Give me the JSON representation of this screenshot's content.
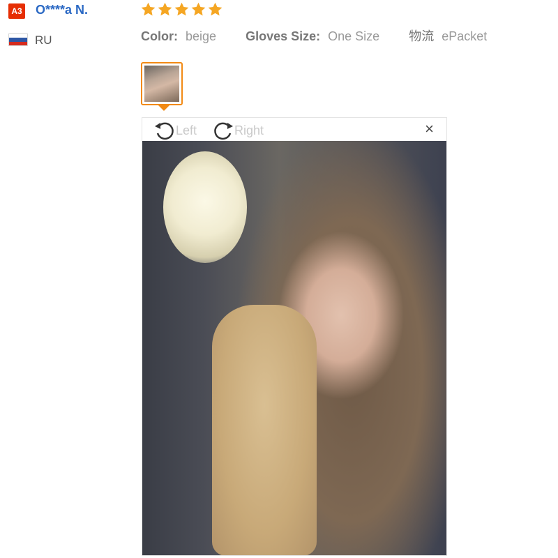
{
  "reviewer": {
    "badge": "A3",
    "name": "O****a N.",
    "country_code": "RU",
    "flag_colors": [
      "#ffffff",
      "#2e57a5",
      "#d52b1e"
    ]
  },
  "rating": {
    "stars": 5,
    "star_color": "#f5a623"
  },
  "attributes": [
    {
      "label": "Color:",
      "value": "beige"
    },
    {
      "label": "Gloves Size:",
      "value": "One Size"
    },
    {
      "label": "物流",
      "value": "ePacket"
    }
  ],
  "viewer": {
    "rotate_left_label": "Left",
    "rotate_right_label": "Right",
    "close_label": "×"
  },
  "accent_color": "#f28a14"
}
